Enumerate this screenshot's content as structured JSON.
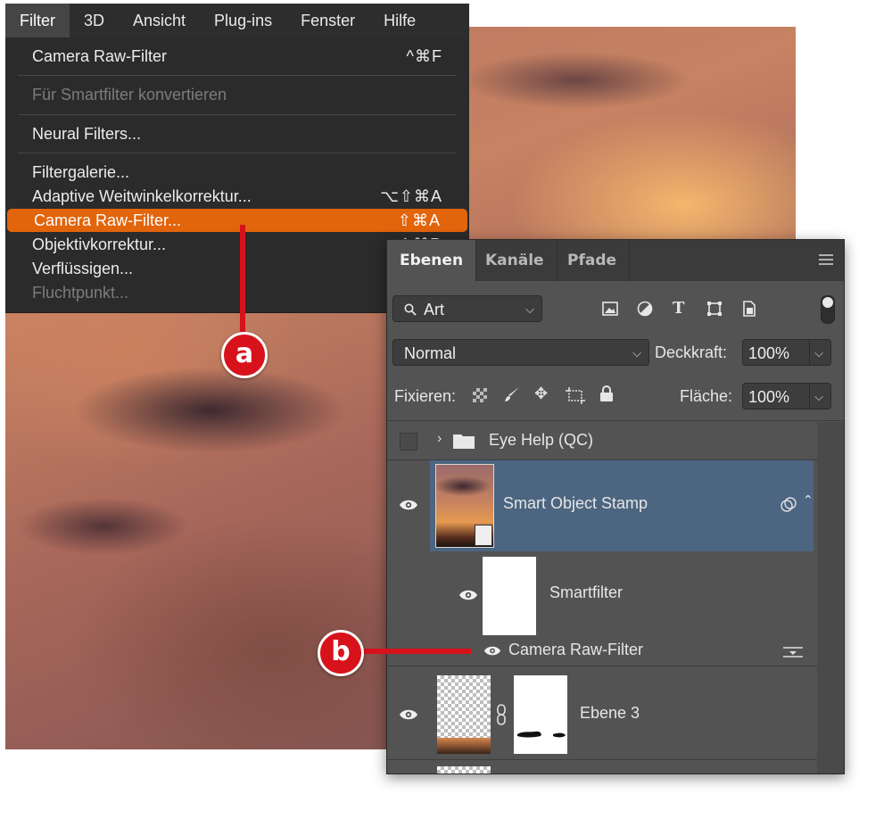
{
  "menubar": {
    "items": [
      "Filter",
      "3D",
      "Ansicht",
      "Plug-ins",
      "Fenster",
      "Hilfe"
    ],
    "active": "Filter"
  },
  "filter_menu": {
    "camera_raw_last": {
      "label": "Camera Raw-Filter",
      "shortcut": "^⌘F"
    },
    "convert_smart": {
      "label": "Für Smartfilter konvertieren"
    },
    "neural": {
      "label": "Neural Filters..."
    },
    "gallery": {
      "label": "Filtergalerie..."
    },
    "adaptive": {
      "label": "Adaptive Weitwinkelkorrektur...",
      "shortcut": "⌥⇧⌘A"
    },
    "camera_raw": {
      "label": "Camera Raw-Filter...",
      "shortcut": "⇧⌘A"
    },
    "lens": {
      "label": "Objektivkorrektur...",
      "shortcut": "⇧⌘R"
    },
    "liquify": {
      "label": "Verflüssigen..."
    },
    "vanishing": {
      "label": "Fluchtpunkt..."
    }
  },
  "callouts": {
    "a": "a",
    "b": "b"
  },
  "layers_panel": {
    "tabs": [
      "Ebenen",
      "Kanäle",
      "Pfade"
    ],
    "active_tab": "Ebenen",
    "filter_kind": "Art",
    "blend_mode": "Normal",
    "opacity_label": "Deckkraft:",
    "opacity_value": "100%",
    "lock_label": "Fixieren:",
    "fill_label": "Fläche:",
    "fill_value": "100%",
    "layers": {
      "group": {
        "name": "Eye Help (QC)"
      },
      "smart_object": {
        "name": "Smart Object Stamp"
      },
      "smartfilter": {
        "name": "Smartfilter"
      },
      "filter_entry": {
        "name": "Camera Raw-Filter"
      },
      "layer3": {
        "name": "Ebene 3"
      }
    }
  },
  "colors": {
    "menu_highlight": "#e2640b",
    "callout_red": "#d7121b",
    "selected_layer": "#4c6580"
  }
}
